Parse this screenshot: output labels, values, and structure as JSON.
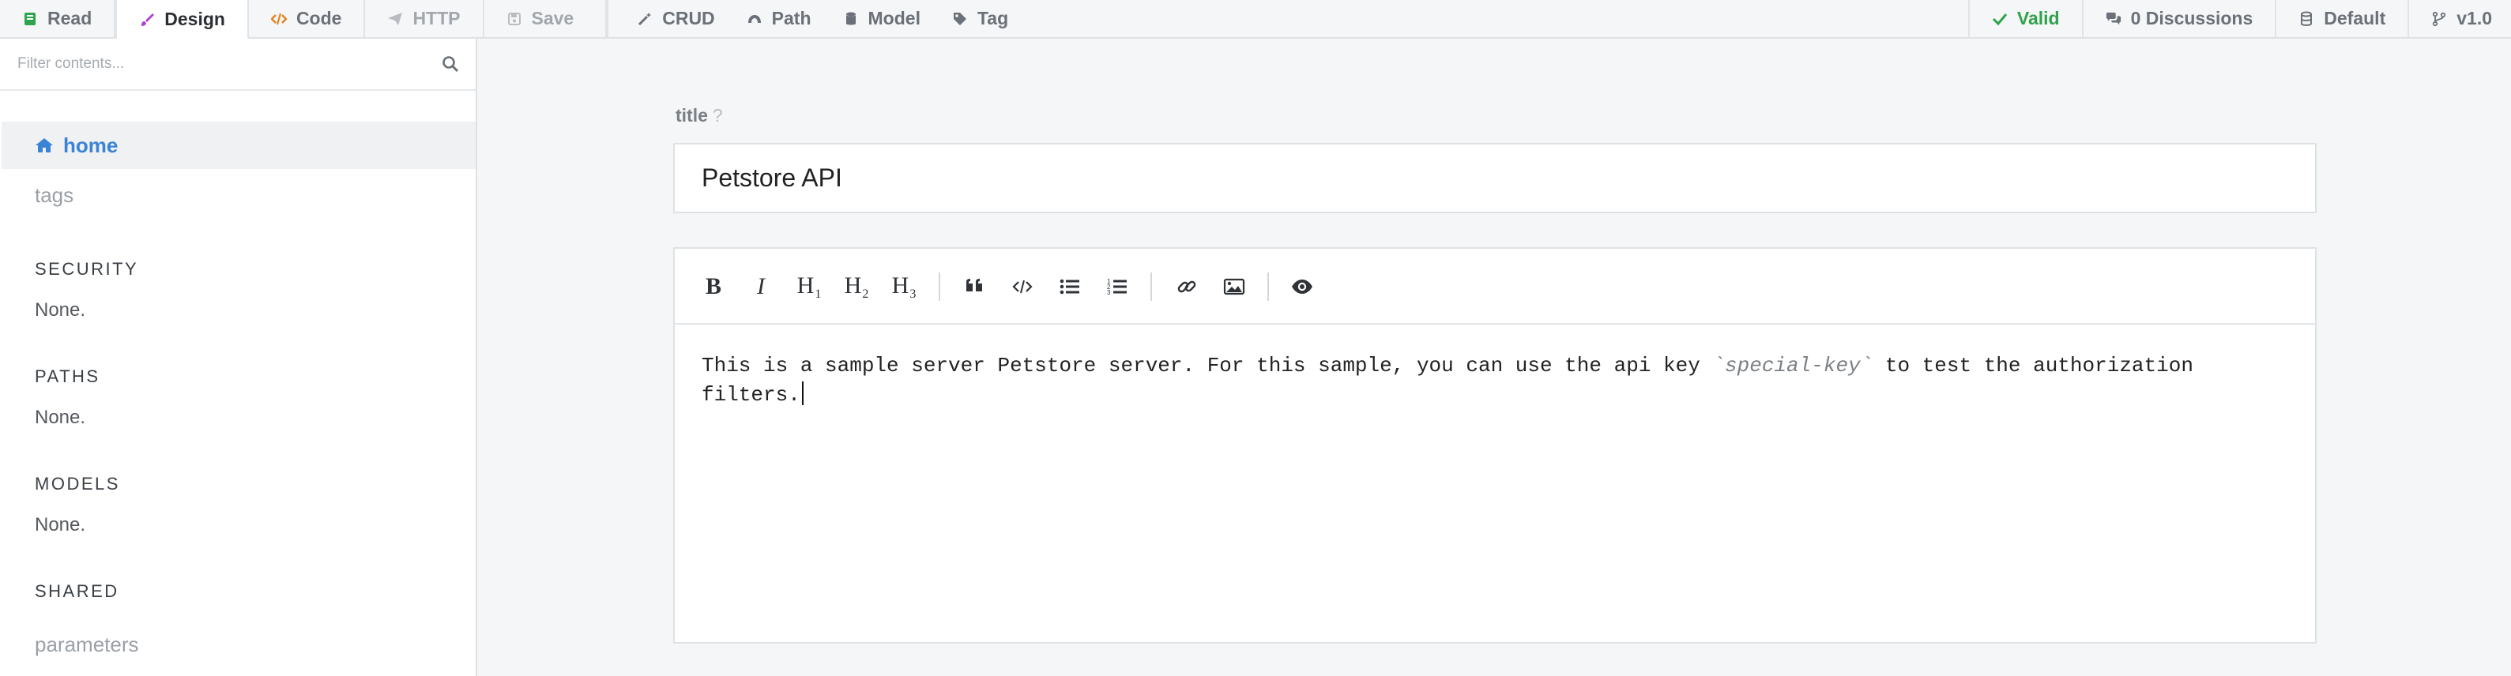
{
  "topbar": {
    "tabs": [
      {
        "label": "Read",
        "icon": "book-icon"
      },
      {
        "label": "Design",
        "icon": "brush-icon"
      },
      {
        "label": "Code",
        "icon": "code-icon"
      },
      {
        "label": "HTTP",
        "icon": "paper-plane-icon"
      },
      {
        "label": "Save",
        "icon": "floppy-icon"
      }
    ],
    "tools": [
      {
        "label": "CRUD",
        "icon": "magic-wand-icon"
      },
      {
        "label": "Path",
        "icon": "road-icon"
      },
      {
        "label": "Model",
        "icon": "database-icon"
      },
      {
        "label": "Tag",
        "icon": "tag-icon"
      }
    ],
    "status": {
      "valid": "Valid",
      "discussions": "0 Discussions",
      "branch": "Default",
      "version": "v1.0"
    },
    "colors": {
      "valid": "#31a24c",
      "design_icon": "#b03fd6",
      "code_icon": "#e5821f",
      "read_icon": "#2ea44f"
    }
  },
  "sidebar": {
    "filter_placeholder": "Filter contents...",
    "home": "home",
    "tags": "tags",
    "sections": [
      {
        "title": "SECURITY",
        "value": "None."
      },
      {
        "title": "PATHS",
        "value": "None."
      },
      {
        "title": "MODELS",
        "value": "None."
      },
      {
        "title": "SHARED",
        "value": ""
      }
    ],
    "parameters": "parameters",
    "accent": "#3a84d6"
  },
  "main": {
    "title_label": "title",
    "title_help": "?",
    "title_value": "Petstore API",
    "editor": {
      "toolbar": [
        "bold-icon",
        "italic-icon",
        "heading-1-icon",
        "heading-2-icon",
        "heading-3-icon",
        "quote-icon",
        "code-icon",
        "unordered-list-icon",
        "ordered-list-icon",
        "link-icon",
        "image-icon",
        "preview-eye-icon"
      ],
      "h_letter": "H",
      "h1_sub": "1",
      "h2_sub": "2",
      "h3_sub": "3",
      "text_before": "This is a sample server Petstore server. For this sample, you can use the api key ",
      "text_code": "`special-key`",
      "text_after": " to test the authorization filters."
    }
  }
}
